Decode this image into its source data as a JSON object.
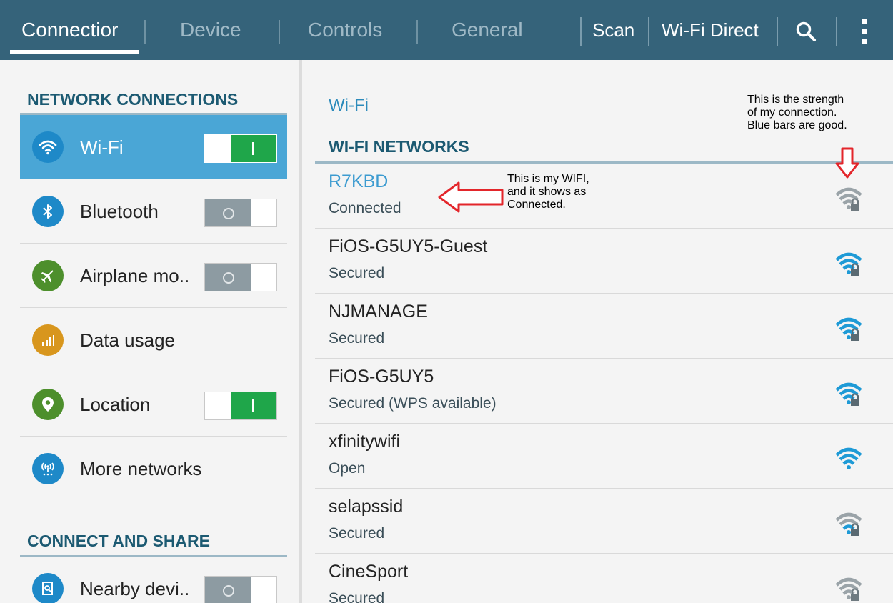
{
  "tabs": [
    {
      "label": "Connectior",
      "active": true
    },
    {
      "label": "Device",
      "active": false
    },
    {
      "label": "Controls",
      "active": false
    },
    {
      "label": "General",
      "active": false
    }
  ],
  "actions": {
    "scan": "Scan",
    "wifi_direct": "Wi-Fi Direct",
    "search_icon": "search-icon",
    "menu_icon": "overflow-menu-icon"
  },
  "left": {
    "network_connections_heading": "NETWORK CONNECTIONS",
    "items": [
      {
        "label": "Wi-Fi",
        "icon": "wifi-icon",
        "toggle": "on",
        "selected": true
      },
      {
        "label": "Bluetooth",
        "icon": "bluetooth-icon",
        "toggle": "off"
      },
      {
        "label": "Airplane mo..",
        "icon": "airplane-icon",
        "toggle": "off"
      },
      {
        "label": "Data usage",
        "icon": "data-usage-icon",
        "toggle": null
      },
      {
        "label": "Location",
        "icon": "location-icon",
        "toggle": "on"
      },
      {
        "label": "More networks",
        "icon": "more-networks-icon",
        "toggle": null
      }
    ],
    "connect_share_heading": "CONNECT AND SHARE",
    "share_items": [
      {
        "label": "Nearby devi..",
        "icon": "nearby-devices-icon",
        "toggle": "off"
      }
    ]
  },
  "right": {
    "title": "Wi-Fi",
    "networks_heading": "WI-FI NETWORKS",
    "networks": [
      {
        "ssid": "R7KBD",
        "status": "Connected",
        "signal": "gray",
        "locked": true
      },
      {
        "ssid": "FiOS-G5UY5-Guest",
        "status": "Secured",
        "signal": "blue",
        "locked": true
      },
      {
        "ssid": "NJMANAGE",
        "status": "Secured",
        "signal": "blue",
        "locked": true
      },
      {
        "ssid": "FiOS-G5UY5",
        "status": "Secured (WPS available)",
        "signal": "blue",
        "locked": true
      },
      {
        "ssid": "xfinitywifi",
        "status": "Open",
        "signal": "blue",
        "locked": false
      },
      {
        "ssid": "selapssid",
        "status": "Secured",
        "signal": "gray",
        "locked": true
      },
      {
        "ssid": "CineSport",
        "status": "Secured",
        "signal": "gray",
        "locked": true
      }
    ]
  },
  "annotations": {
    "my_wifi": [
      "This is my WIFI,",
      "and it shows as",
      "Connected."
    ],
    "strength": [
      "This is the strength",
      "of  my  connection.",
      "Blue bars are good."
    ]
  },
  "colors": {
    "bar": "#35637a",
    "accent": "#4aa6d6",
    "toggle_on": "#1fa64a",
    "signal_blue": "#1e9ad6",
    "signal_gray": "#9aa3a8",
    "annotation_arrow": "#e3262b"
  }
}
